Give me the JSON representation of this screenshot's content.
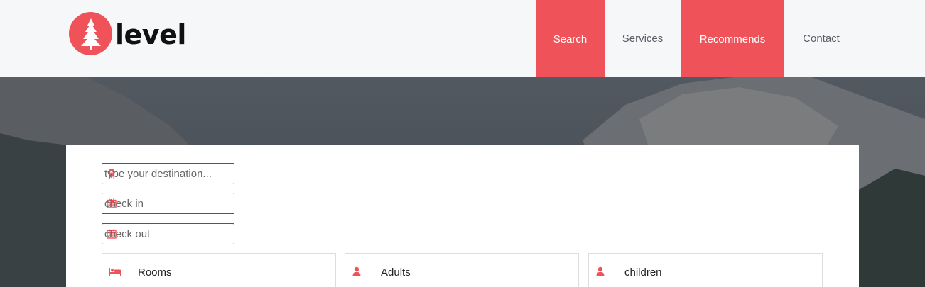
{
  "brand": {
    "name": "level",
    "accent": "#ef5259"
  },
  "nav": {
    "items": [
      {
        "label": "Search",
        "active": true
      },
      {
        "label": "Services",
        "active": false
      },
      {
        "label": "Recommends",
        "active": true
      },
      {
        "label": "Contact",
        "active": false
      }
    ]
  },
  "search": {
    "destination": {
      "placeholder": "type your destination...",
      "icon": "map-pin-icon"
    },
    "check_in": {
      "placeholder": "check in",
      "icon": "calendar-icon"
    },
    "check_out": {
      "placeholder": "check out",
      "icon": "calendar-icon"
    },
    "rooms": {
      "label": "Rooms",
      "icon": "bed-icon"
    },
    "adults": {
      "label": "Adults",
      "icon": "user-icon"
    },
    "children": {
      "label": "children",
      "icon": "user-icon"
    }
  }
}
